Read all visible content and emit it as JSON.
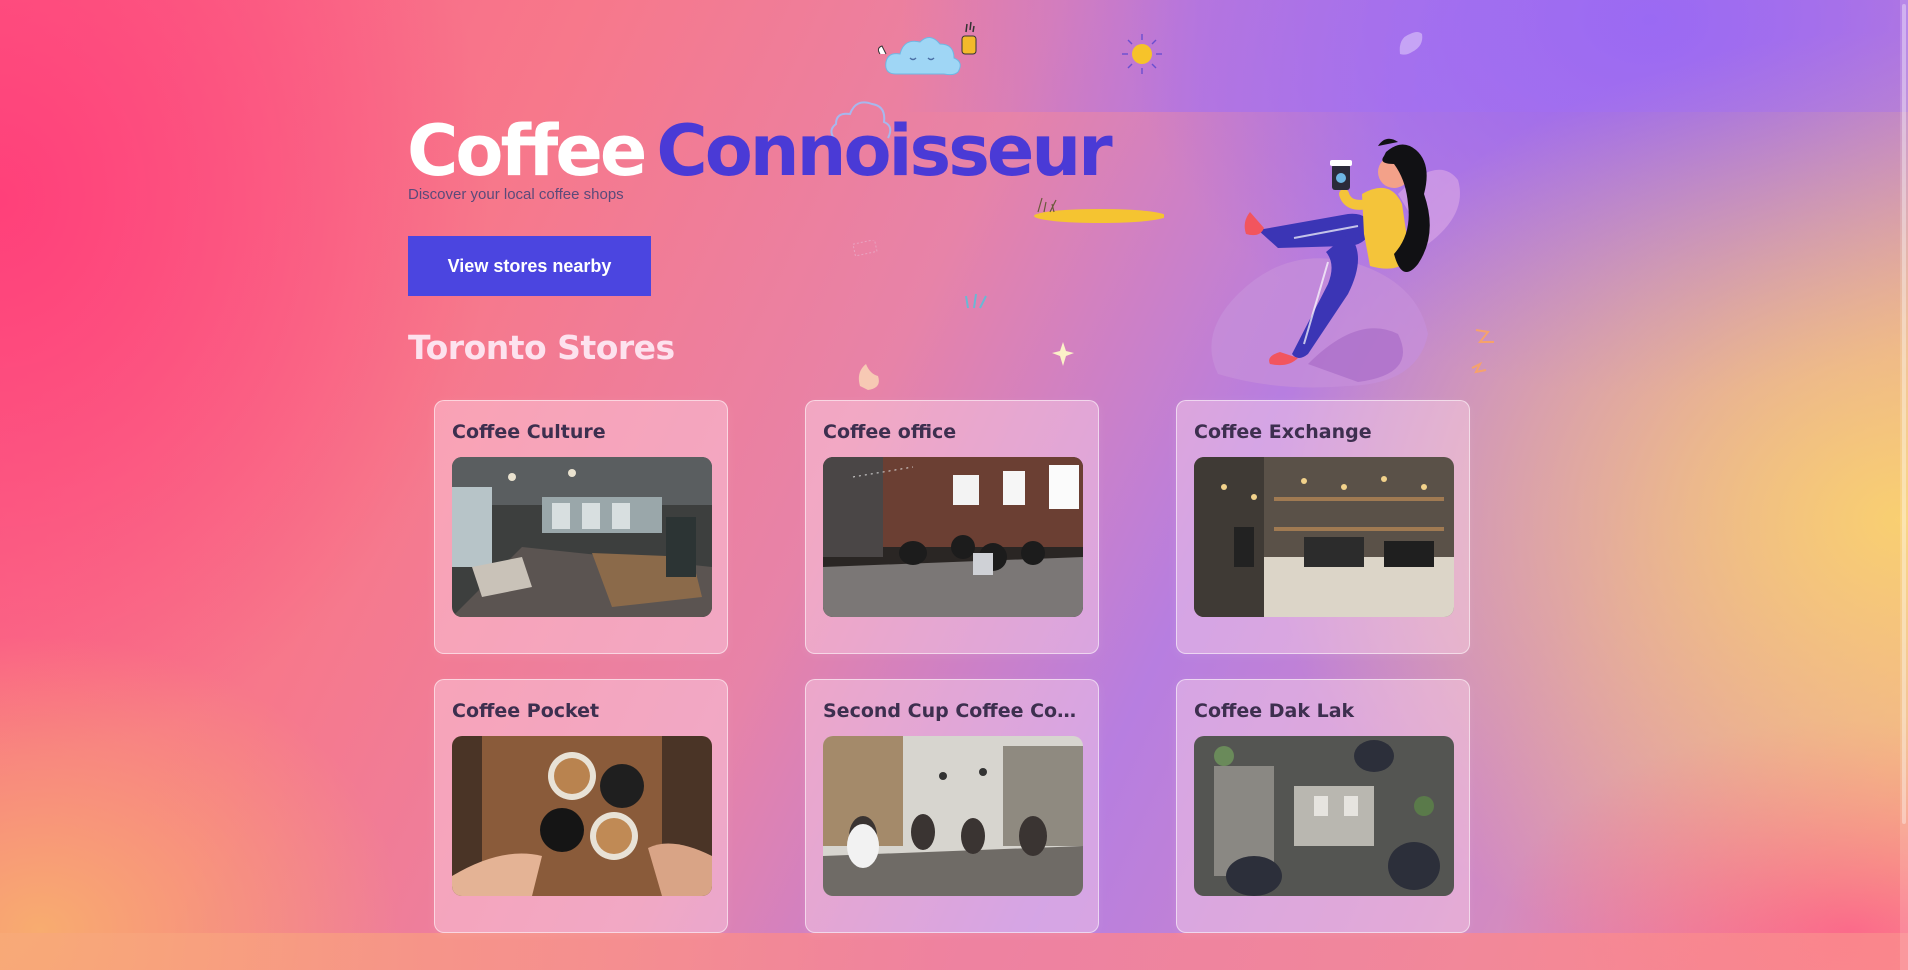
{
  "hero": {
    "title_part1": "Coffee",
    "title_part2": "Connoisseur",
    "subtitle": "Discover your local coffee shops",
    "cta_label": "View stores nearby"
  },
  "section": {
    "title": "Toronto Stores"
  },
  "stores": [
    {
      "name": "Coffee Culture",
      "image": "cafe-interior-industrial"
    },
    {
      "name": "Coffee office",
      "image": "cafe-interior-brick"
    },
    {
      "name": "Coffee Exchange",
      "image": "cafe-counter-shelves"
    },
    {
      "name": "Coffee Pocket",
      "image": "latte-cups-toast"
    },
    {
      "name": "Second Cup Coffee Co. fe...",
      "image": "cafe-interior-crowded"
    },
    {
      "name": "Coffee Dak Lak",
      "image": "baristas-topdown"
    }
  ],
  "colors": {
    "brand_indigo": "#4b45e0",
    "title_purple": "#4a3ad6",
    "card_text": "#3d2f4f"
  }
}
